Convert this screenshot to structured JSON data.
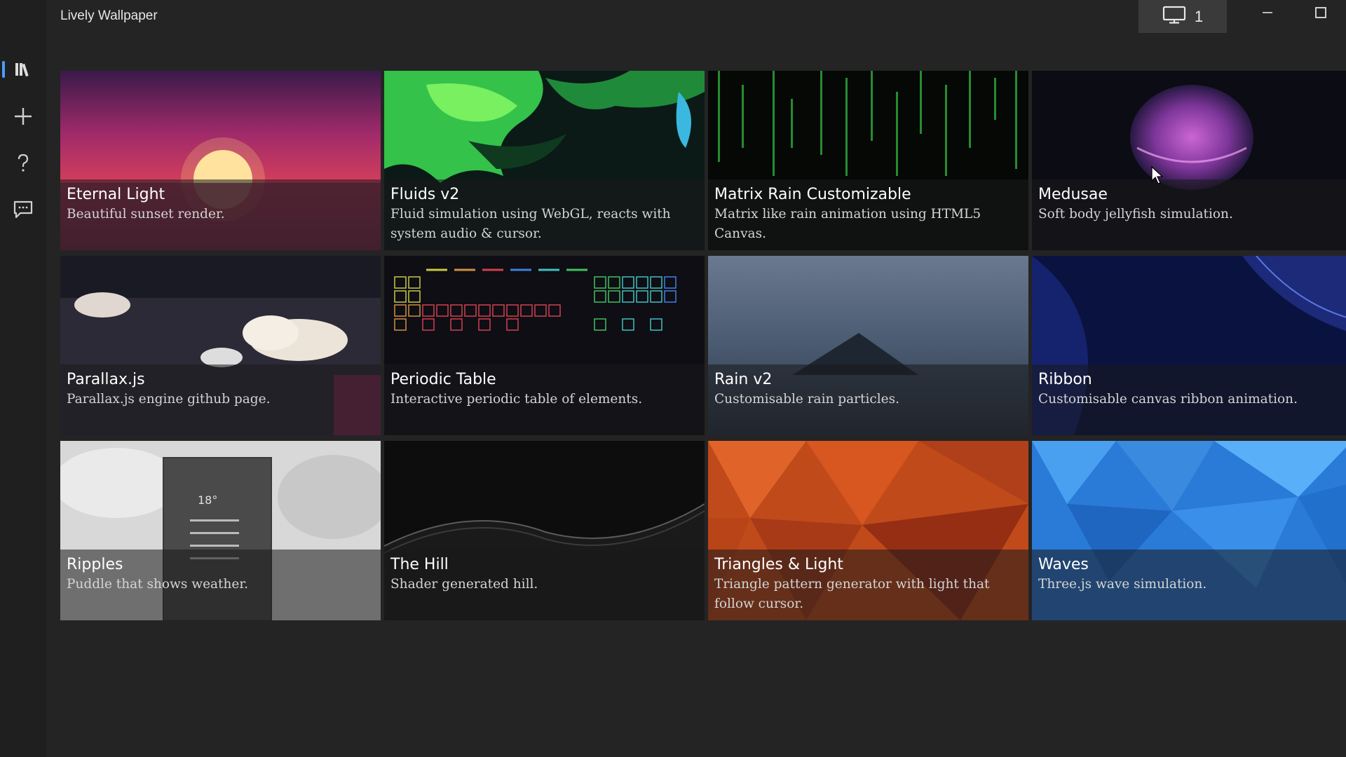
{
  "app": {
    "title": "Lively Wallpaper",
    "monitor_count": "1"
  },
  "sidebar": {
    "items": [
      {
        "name": "library",
        "icon": "library-icon"
      },
      {
        "name": "add",
        "icon": "plus-icon"
      },
      {
        "name": "help",
        "icon": "question-icon"
      },
      {
        "name": "feedback",
        "icon": "feedback-icon"
      }
    ]
  },
  "wallpapers": [
    {
      "title": "Eternal Light",
      "desc": "Beautiful sunset render."
    },
    {
      "title": "Fluids v2",
      "desc": "Fluid simulation using WebGL, reacts with system audio & cursor."
    },
    {
      "title": "Matrix Rain Customizable",
      "desc": "Matrix like rain animation using HTML5 Canvas."
    },
    {
      "title": "Medusae",
      "desc": "Soft body jellyfish simulation."
    },
    {
      "title": "Parallax.js",
      "desc": "Parallax.js engine github page."
    },
    {
      "title": "Periodic Table",
      "desc": "Interactive periodic table of elements."
    },
    {
      "title": "Rain v2",
      "desc": "Customisable rain particles."
    },
    {
      "title": "Ribbon",
      "desc": "Customisable canvas ribbon animation."
    },
    {
      "title": "Ripples",
      "desc": "Puddle that shows weather."
    },
    {
      "title": "The Hill",
      "desc": "Shader generated hill."
    },
    {
      "title": "Triangles & Light",
      "desc": "Triangle pattern generator with light that follow cursor."
    },
    {
      "title": "Waves",
      "desc": "Three.js wave simulation."
    }
  ],
  "ripples_thumb": {
    "temp": "18°"
  },
  "colors": {
    "accent": "#2e76c9",
    "background": "#242424",
    "sidebar": "#1f1f1f"
  }
}
